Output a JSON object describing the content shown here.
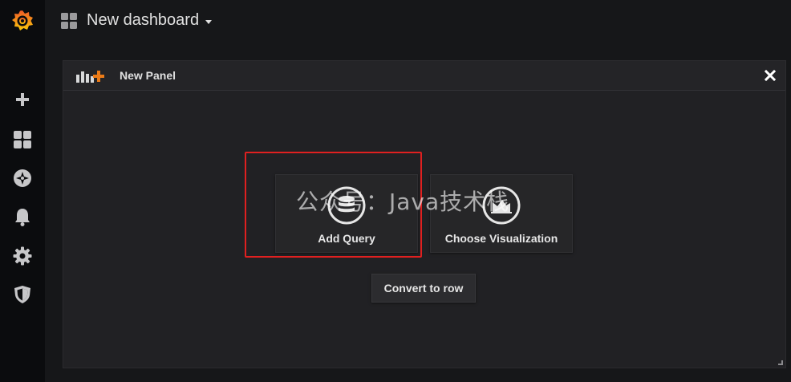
{
  "header": {
    "dashboard_title": "New dashboard"
  },
  "sidebar": {
    "items": [
      {
        "name": "grafana-logo-icon"
      },
      {
        "name": "plus-icon"
      },
      {
        "name": "dashboards-icon"
      },
      {
        "name": "explore-compass-icon"
      },
      {
        "name": "bell-icon"
      },
      {
        "name": "gear-icon"
      },
      {
        "name": "shield-icon"
      }
    ]
  },
  "panel": {
    "title": "New Panel",
    "options": [
      {
        "label": "Add Query",
        "icon": "database-icon"
      },
      {
        "label": "Choose Visualization",
        "icon": "chart-area-icon"
      }
    ],
    "convert_label": "Convert to row"
  },
  "watermark": "公众号：Java技术栈",
  "colors": {
    "accent": "#eb7b18",
    "highlight": "#e02020"
  }
}
